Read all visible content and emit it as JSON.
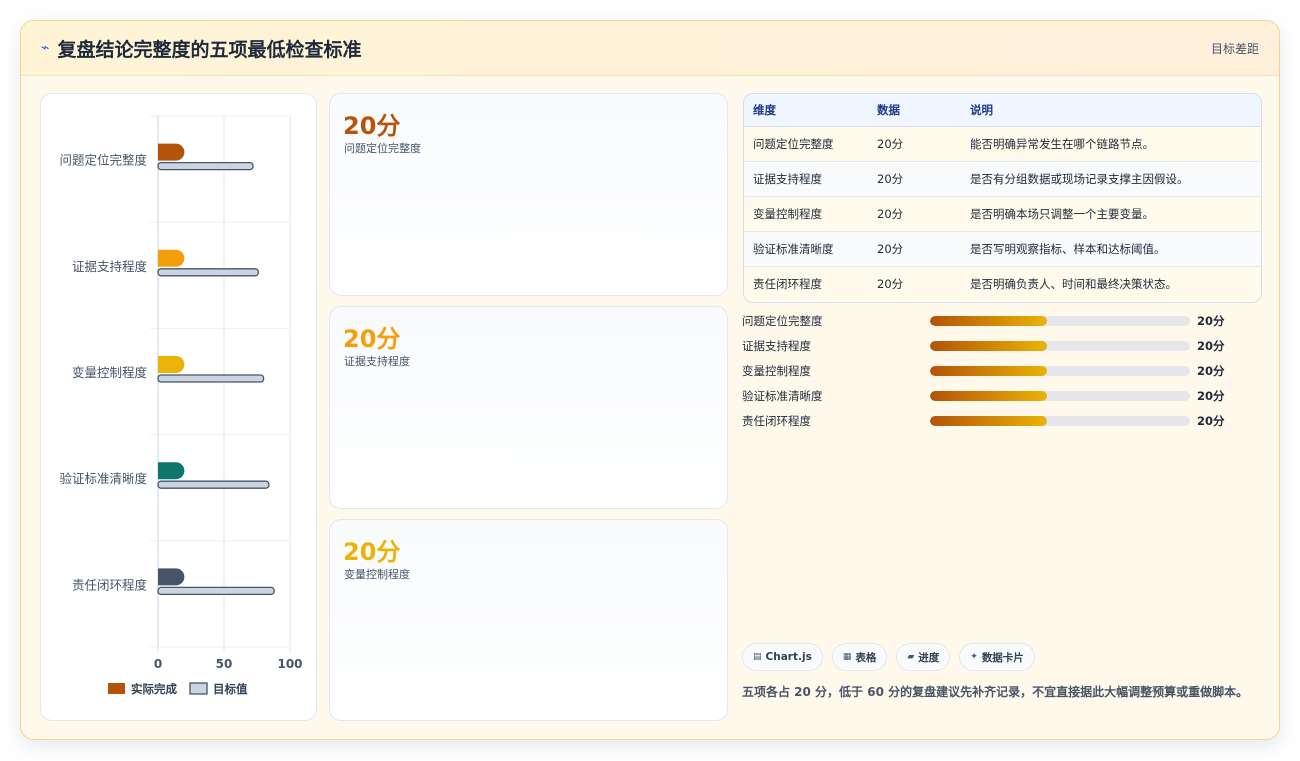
{
  "header": {
    "title": "复盘结论完整度的五项最低检查标准",
    "title_icon": "bolt-icon",
    "right_label": "目标差距"
  },
  "colors": {
    "c0": "#b45309",
    "c1": "#f59e0b",
    "c2": "#eab308",
    "c3": "#0f766e",
    "c4": "#475569",
    "target": "#cbd5e1"
  },
  "chart_data": {
    "type": "bar",
    "orientation": "horizontal",
    "categories": [
      "问题定位完整度",
      "证据支持程度",
      "变量控制程度",
      "验证标准清晰度",
      "责任闭环程度"
    ],
    "series": [
      {
        "name": "实际完成",
        "values": [
          20,
          20,
          20,
          20,
          20
        ]
      },
      {
        "name": "目标值",
        "values": [
          72,
          76,
          80,
          84,
          88
        ]
      }
    ],
    "xlim": [
      0,
      100
    ],
    "xticks": [
      "0",
      "50",
      "100"
    ],
    "grid": true,
    "legend": "bottom"
  },
  "kpis": [
    {
      "value": "20分",
      "label": "问题定位完整度",
      "color": "#b45309"
    },
    {
      "value": "20分",
      "label": "证据支持程度",
      "color": "#f59e0b"
    },
    {
      "value": "20分",
      "label": "变量控制程度",
      "color": "#eab308"
    }
  ],
  "table": {
    "headers": [
      "维度",
      "数据",
      "说明"
    ],
    "rows": [
      [
        "问题定位完整度",
        "20分",
        "能否明确异常发生在哪个链路节点。"
      ],
      [
        "证据支持程度",
        "20分",
        "是否有分组数据或现场记录支撑主因假设。"
      ],
      [
        "变量控制程度",
        "20分",
        "是否明确本场只调整一个主要变量。"
      ],
      [
        "验证标准清晰度",
        "20分",
        "是否写明观察指标、样本和达标阈值。"
      ],
      [
        "责任闭环程度",
        "20分",
        "是否明确负责人、时间和最终决策状态。"
      ]
    ]
  },
  "progress": [
    {
      "label": "问题定位完整度",
      "value": "20分",
      "fraction": 0.45
    },
    {
      "label": "证据支持程度",
      "value": "20分",
      "fraction": 0.45
    },
    {
      "label": "变量控制程度",
      "value": "20分",
      "fraction": 0.45
    },
    {
      "label": "验证标准清晰度",
      "value": "20分",
      "fraction": 0.45
    },
    {
      "label": "责任闭环程度",
      "value": "20分",
      "fraction": 0.45
    }
  ],
  "chips": [
    {
      "icon": "chart-icon",
      "glyph": "▤",
      "label": "Chart.js"
    },
    {
      "icon": "table-icon",
      "glyph": "▦",
      "label": "表格"
    },
    {
      "icon": "progress-icon",
      "glyph": "▰",
      "label": "进度"
    },
    {
      "icon": "card-icon",
      "glyph": "✦",
      "label": "数据卡片"
    }
  ],
  "note": "五项各占 20 分，低于 60 分的复盘建议先补齐记录，不宜直接据此大幅调整预算或重做脚本。"
}
